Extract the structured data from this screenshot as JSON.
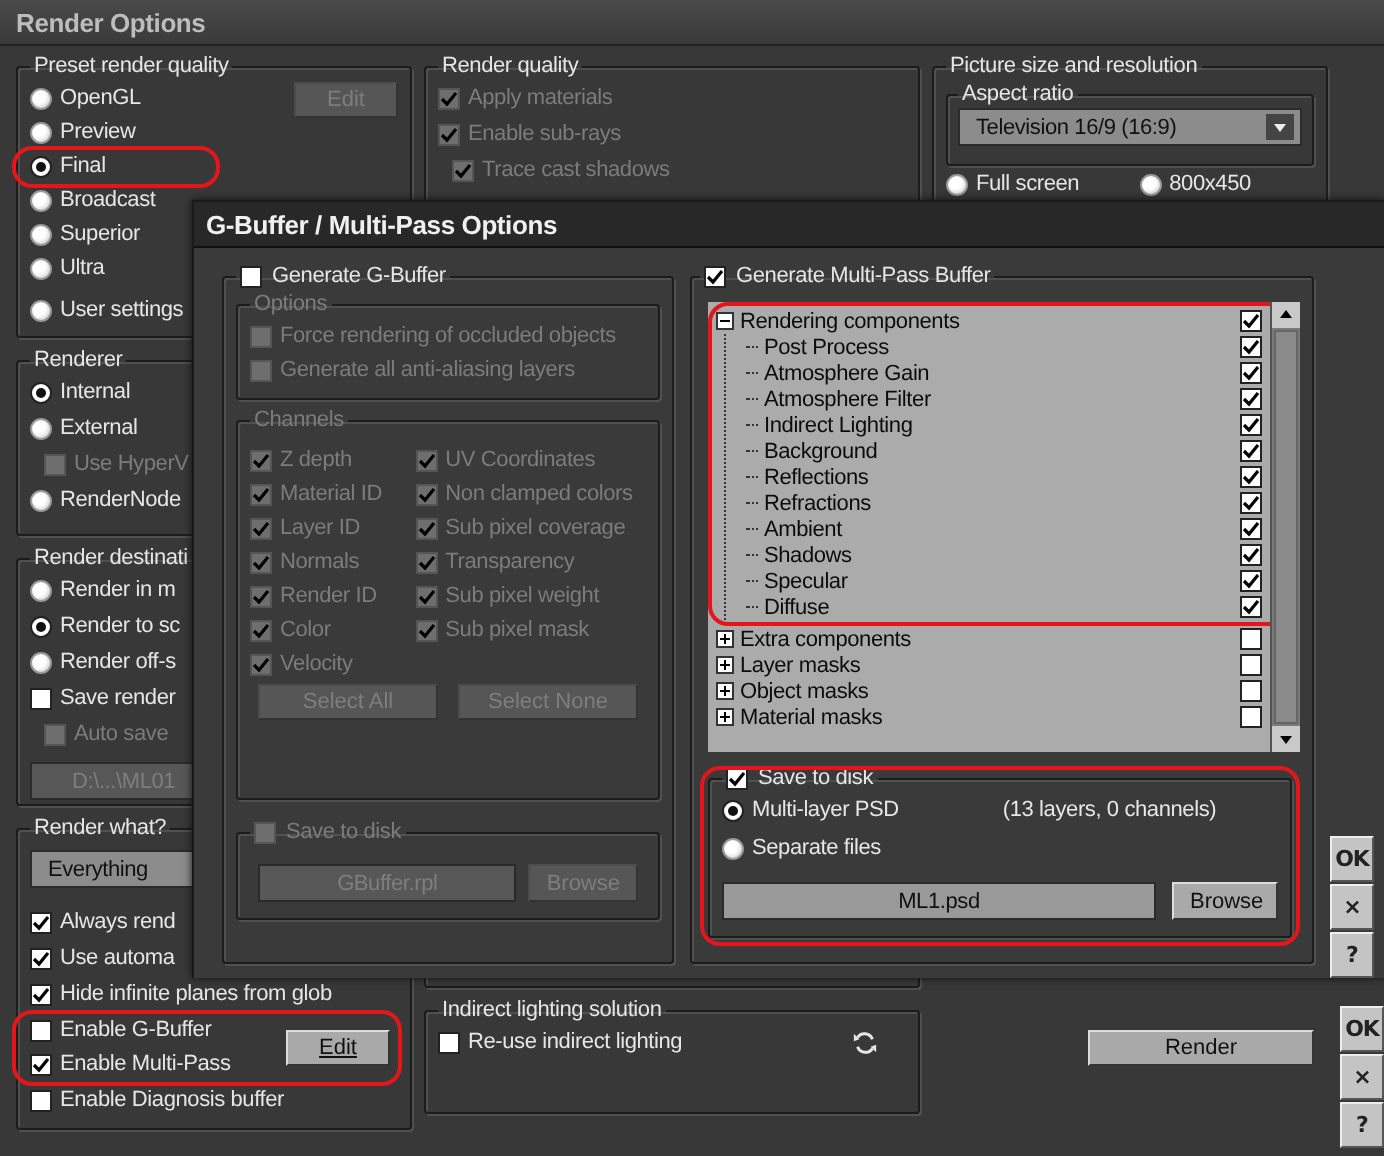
{
  "window": {
    "title": "Render Options"
  },
  "preset": {
    "title": "Preset render quality",
    "edit": {
      "label": "Edit",
      "disabled": true
    },
    "options": [
      {
        "label": "OpenGL",
        "selected": false
      },
      {
        "label": "Preview",
        "selected": false
      },
      {
        "label": "Final",
        "selected": true
      },
      {
        "label": "Broadcast",
        "selected": false
      },
      {
        "label": "Superior",
        "selected": false
      },
      {
        "label": "Ultra",
        "selected": false
      },
      {
        "label": "User settings",
        "selected": false
      }
    ]
  },
  "renderer": {
    "title": "Renderer",
    "items": [
      {
        "kind": "radio",
        "label": "Internal",
        "selected": true
      },
      {
        "kind": "radio",
        "label": "External",
        "selected": false,
        "children": [
          {
            "kind": "checkbox",
            "label": "Use HyperV",
            "checked": false,
            "disabled": true
          }
        ]
      },
      {
        "kind": "radio",
        "label": "RenderNode",
        "selected": false
      }
    ]
  },
  "render_destination": {
    "title": "Render destinati",
    "items": [
      {
        "kind": "radio",
        "label": "Render in m",
        "selected": false
      },
      {
        "kind": "radio",
        "label": "Render to sc",
        "selected": true
      },
      {
        "kind": "radio",
        "label": "Render off-s",
        "selected": false
      },
      {
        "kind": "checkbox",
        "label": "Save render",
        "checked": false,
        "children": [
          {
            "kind": "checkbox",
            "label": "Auto save",
            "checked": false,
            "disabled": true
          }
        ]
      }
    ],
    "path": {
      "value": "D:\\...\\ML01",
      "disabled": true
    }
  },
  "render_what": {
    "title": "Render what?",
    "dropdown": "Everything",
    "options": [
      {
        "label": "Always rend",
        "checked": true
      },
      {
        "label": "Use automa",
        "checked": true
      },
      {
        "label": "Hide infinite planes from glob",
        "checked": true
      },
      {
        "label": "Enable G-Buffer",
        "checked": false
      },
      {
        "label": "Enable Multi-Pass",
        "checked": true
      },
      {
        "label": "Enable Diagnosis buffer",
        "checked": false
      }
    ],
    "edit": "Edit"
  },
  "render_quality": {
    "title": "Render quality",
    "disabled": true,
    "items": [
      {
        "label": "Apply materials",
        "checked": true
      },
      {
        "label": "Enable sub-rays",
        "checked": true,
        "children": [
          {
            "label": "Trace cast shadows",
            "checked": true
          }
        ]
      }
    ]
  },
  "picture_size": {
    "title": "Picture size and resolution",
    "aspect_ratio": {
      "title": "Aspect ratio",
      "value": "Television 16/9 (16:9)"
    },
    "sizes": [
      {
        "label": "Full screen",
        "selected": false
      },
      {
        "label": "800x450",
        "selected": false
      }
    ]
  },
  "indirect_lighting": {
    "title": "Indirect lighting solution",
    "reuse": {
      "label": "Re-use indirect lighting",
      "checked": false
    }
  },
  "render_button": "Render",
  "window_buttons": [
    "OK",
    "×",
    "?"
  ],
  "dialog": {
    "title": "G-Buffer / Multi-Pass Options",
    "gbuffer": {
      "label": "Generate G-Buffer",
      "checked": false,
      "options": {
        "title": "Options",
        "items": [
          {
            "label": "Force rendering of occluded objects",
            "checked": false
          },
          {
            "label": "Generate all anti-aliasing layers",
            "checked": false
          }
        ]
      },
      "channels": {
        "title": "Channels",
        "items": [
          {
            "label": "Z depth",
            "checked": true
          },
          {
            "label": "Material ID",
            "checked": true
          },
          {
            "label": "Layer ID",
            "checked": true
          },
          {
            "label": "Normals",
            "checked": true
          },
          {
            "label": "Render ID",
            "checked": true
          },
          {
            "label": "Color",
            "checked": true
          },
          {
            "label": "Velocity",
            "checked": true
          },
          {
            "label": "UV Coordinates",
            "checked": true
          },
          {
            "label": "Non clamped colors",
            "checked": true
          },
          {
            "label": "Sub pixel coverage",
            "checked": true
          },
          {
            "label": "Transparency",
            "checked": true
          },
          {
            "label": "Sub pixel weight",
            "checked": true
          },
          {
            "label": "Sub pixel mask",
            "checked": true
          }
        ]
      },
      "select_all": "Select All",
      "select_none": "Select None",
      "save_to_disk": {
        "label": "Save to disk",
        "checked": false,
        "file": "GBuffer.rpl",
        "browse": "Browse"
      }
    },
    "multipass": {
      "label": "Generate Multi-Pass Buffer",
      "checked": true,
      "tree": [
        {
          "label": "Rendering components",
          "checked": true,
          "expanded": true,
          "children": [
            {
              "label": "Post Process",
              "checked": true
            },
            {
              "label": "Atmosphere Gain",
              "checked": true
            },
            {
              "label": "Atmosphere Filter",
              "checked": true
            },
            {
              "label": "Indirect Lighting",
              "checked": true
            },
            {
              "label": "Background",
              "checked": true
            },
            {
              "label": "Reflections",
              "checked": true
            },
            {
              "label": "Refractions",
              "checked": true
            },
            {
              "label": "Ambient",
              "checked": true
            },
            {
              "label": "Shadows",
              "checked": true
            },
            {
              "label": "Specular",
              "checked": true
            },
            {
              "label": "Diffuse",
              "checked": true
            }
          ]
        },
        {
          "label": "Extra components",
          "checked": false,
          "expanded": false
        },
        {
          "label": "Layer masks",
          "checked": false,
          "expanded": false
        },
        {
          "label": "Object masks",
          "checked": false,
          "expanded": false
        },
        {
          "label": "Material masks",
          "checked": false,
          "expanded": false
        }
      ],
      "save_to_disk": {
        "label": "Save to disk",
        "checked": true,
        "formats": [
          {
            "label": "Multi-layer PSD",
            "selected": true
          },
          {
            "label": "Separate files",
            "selected": false
          }
        ],
        "info": "(13 layers, 0 channels)",
        "file": "ML1.psd",
        "browse": "Browse"
      }
    },
    "buttons": [
      "OK",
      "×",
      "?"
    ]
  }
}
